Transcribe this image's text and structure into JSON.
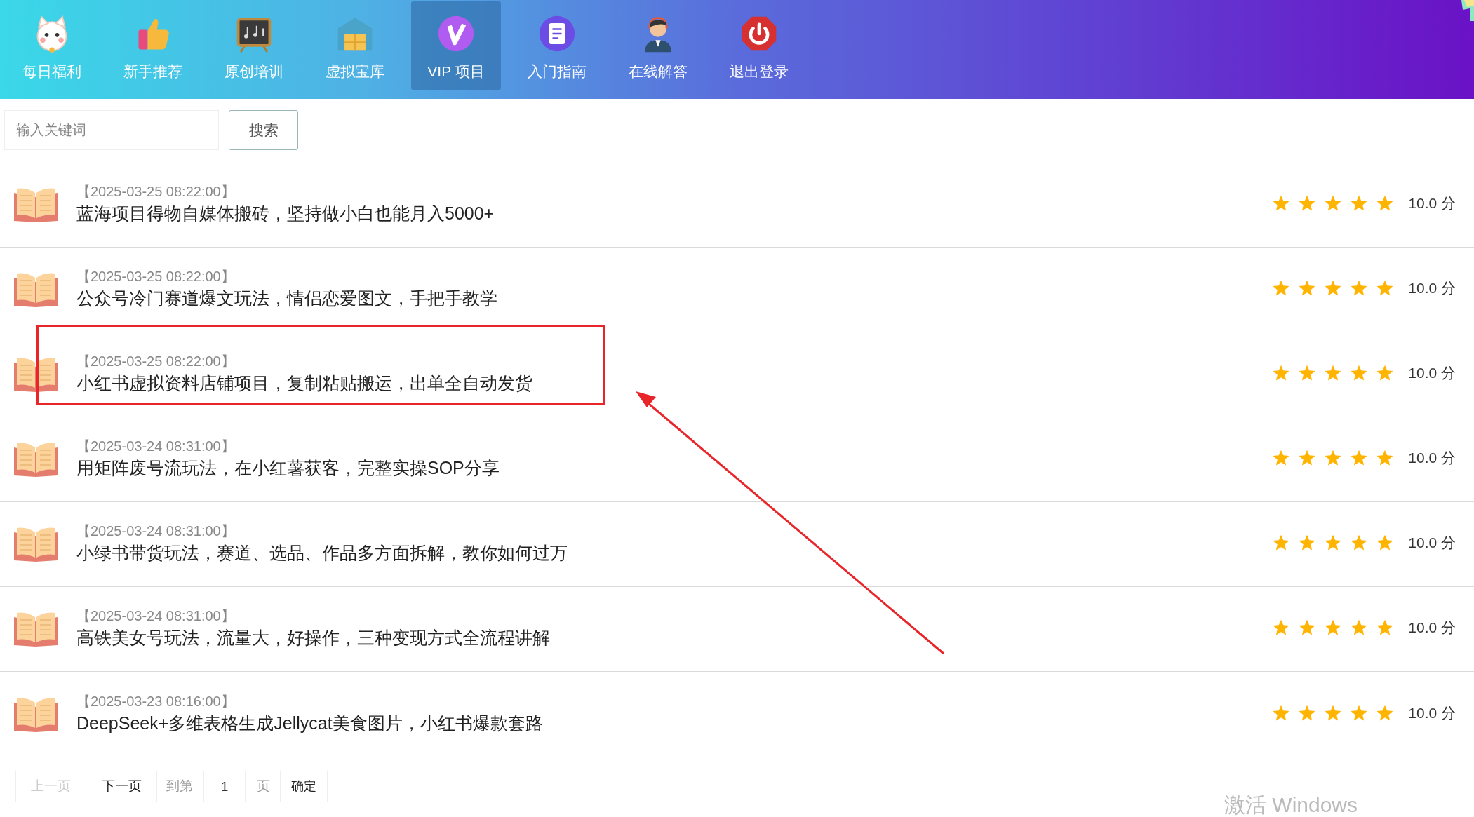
{
  "nav": [
    {
      "label": "每日福利",
      "selected": false
    },
    {
      "label": "新手推荐",
      "selected": false
    },
    {
      "label": "原创培训",
      "selected": false
    },
    {
      "label": "虚拟宝库",
      "selected": false
    },
    {
      "label": "VIP 项目",
      "selected": true
    },
    {
      "label": "入门指南",
      "selected": false
    },
    {
      "label": "在线解答",
      "selected": false
    },
    {
      "label": "退出登录",
      "selected": false
    }
  ],
  "search": {
    "placeholder": "输入关键词",
    "button": "搜索"
  },
  "articles": [
    {
      "date": "【2025-03-25 08:22:00】",
      "title": "蓝海项目得物自媒体搬砖，坚持做小白也能月入5000+",
      "stars": 5,
      "score": "10.0 分"
    },
    {
      "date": "【2025-03-25 08:22:00】",
      "title": "公众号冷门赛道爆文玩法，情侣恋爱图文，手把手教学",
      "stars": 5,
      "score": "10.0 分"
    },
    {
      "date": "【2025-03-25 08:22:00】",
      "title": "小红书虚拟资料店铺项目，复制粘贴搬运，出单全自动发货",
      "stars": 5,
      "score": "10.0 分"
    },
    {
      "date": "【2025-03-24 08:31:00】",
      "title": "用矩阵废号流玩法，在小红薯获客，完整实操SOP分享",
      "stars": 5,
      "score": "10.0 分"
    },
    {
      "date": "【2025-03-24 08:31:00】",
      "title": "小绿书带货玩法，赛道、选品、作品多方面拆解，教你如何过万",
      "stars": 5,
      "score": "10.0 分"
    },
    {
      "date": "【2025-03-24 08:31:00】",
      "title": "高铁美女号玩法，流量大，好操作，三种变现方式全流程讲解",
      "stars": 5,
      "score": "10.0 分"
    },
    {
      "date": "【2025-03-23 08:16:00】",
      "title": "DeepSeek+多维表格生成Jellycat美食图片，小红书爆款套路",
      "stars": 5,
      "score": "10.0 分"
    }
  ],
  "pagination": {
    "prev": {
      "label": "上一页",
      "disabled": true
    },
    "next": {
      "label": "下一页",
      "disabled": false
    },
    "goto_label": "到第",
    "page_value": "1",
    "page_unit": "页",
    "confirm": "确定"
  },
  "windows_notice": "激活 Windows"
}
